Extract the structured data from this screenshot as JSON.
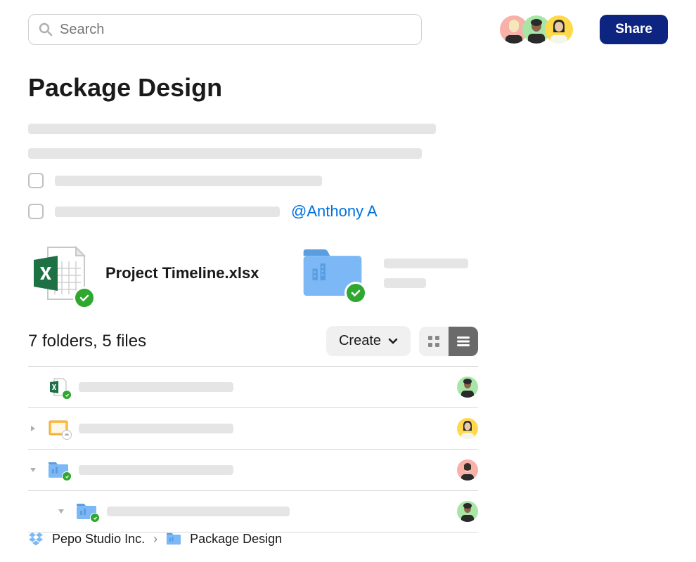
{
  "search": {
    "placeholder": "Search"
  },
  "header": {
    "share_label": "Share",
    "avatar_colors": [
      "#f7b1a8",
      "#a8e6a8",
      "#ffd94a"
    ]
  },
  "page": {
    "title": "Package Design",
    "mention": "@Anthony A"
  },
  "cards": {
    "file_name": "Project Timeline.xlsx"
  },
  "counts": {
    "text": "7 folders, 5 files"
  },
  "toolbar": {
    "create_label": "Create"
  },
  "list": {
    "rows": [
      {
        "type": "excel",
        "avatar_bg": "#a8e6a8",
        "expand": "none"
      },
      {
        "type": "slides",
        "avatar_bg": "#ffd94a",
        "expand": "right"
      },
      {
        "type": "folder",
        "avatar_bg": "#f7b1a8",
        "expand": "down"
      },
      {
        "type": "folder",
        "avatar_bg": "#a8e6a8",
        "expand": "down",
        "indent": 1
      }
    ]
  },
  "breadcrumb": {
    "items": [
      "Pepo Studio Inc.",
      "Package Design"
    ]
  },
  "colors": {
    "accent": "#0d2481",
    "link": "#0070e0",
    "folder": "#7cb8f5",
    "excel": "#1e7145",
    "slides": "#ffc04a",
    "check": "#2ea82e"
  }
}
